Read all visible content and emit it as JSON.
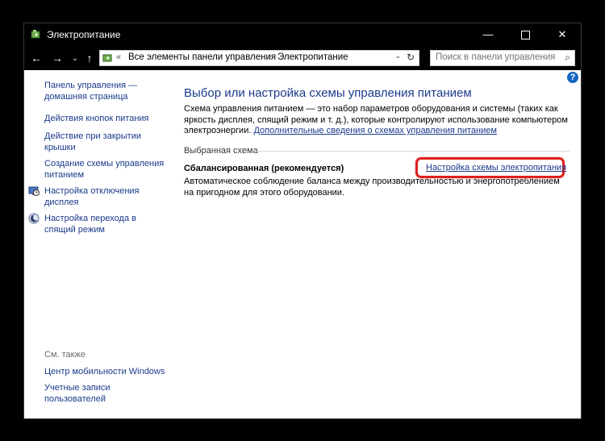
{
  "window": {
    "title": "Электропитание",
    "controls": {
      "minimize": "—",
      "close": "✕"
    }
  },
  "nav": {
    "back": "←",
    "forward": "→",
    "recent": "⌄",
    "up": "↑"
  },
  "address": {
    "prefix": "«",
    "crumbs": [
      "Все элементы панели управления",
      "Электропитание"
    ],
    "separator": "›",
    "dropdown": "⌄",
    "refresh": "↻"
  },
  "search": {
    "placeholder": "Поиск в панели управления",
    "icon": "⌕"
  },
  "help": {
    "label": "?"
  },
  "sidebar": {
    "items": [
      {
        "label": "Панель управления — домашняя страница"
      },
      {
        "label": "Действия кнопок питания"
      },
      {
        "label": "Действие при закрытии крышки"
      },
      {
        "label": "Создание схемы управления питанием"
      },
      {
        "label": "Настройка отключения дисплея",
        "icon": "monitor-clock-icon"
      },
      {
        "label": "Настройка перехода в спящий режим",
        "icon": "moon-icon"
      }
    ],
    "see_also": {
      "title": "См. также",
      "items": [
        {
          "label": "Центр мобильности Windows"
        },
        {
          "label": "Учетные записи пользователей"
        }
      ]
    }
  },
  "main": {
    "title": "Выбор или настройка схемы управления питанием",
    "description": "Схема управления питанием — это набор параметров оборудования и системы (таких как яркость дисплея, спящий режим и т. д.), которые контролируют использование компьютером электроэнергии.",
    "more_link": "Дополнительные сведения о схемах управления питанием",
    "section_label": "Выбранная схема",
    "plan": {
      "name": "Сбалансированная (рекомендуется)",
      "description": "Автоматическое соблюдение баланса между производительностью и энергопотреблением на пригодном для этого оборудовании.",
      "settings_link": "Настройка схемы электропитания"
    }
  },
  "colors": {
    "link": "#1a3a8b",
    "highlight": "#e02020",
    "titlebar": "#000000"
  }
}
